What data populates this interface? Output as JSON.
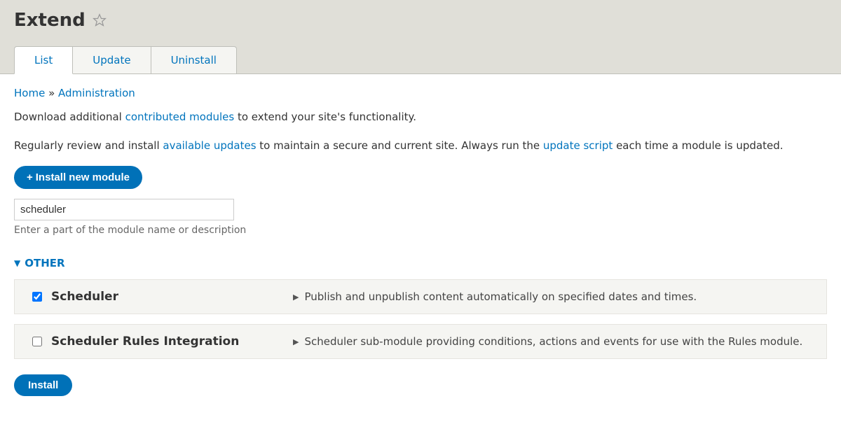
{
  "header": {
    "title": "Extend"
  },
  "tabs": [
    {
      "label": "List",
      "active": true
    },
    {
      "label": "Update",
      "active": false
    },
    {
      "label": "Uninstall",
      "active": false
    }
  ],
  "breadcrumb": {
    "home": "Home",
    "sep": " » ",
    "admin": "Administration"
  },
  "intro": {
    "pre1": "Download additional ",
    "link1": "contributed modules",
    "post1": " to extend your site's functionality.",
    "pre2": "Regularly review and install ",
    "link2": "available updates",
    "mid2": " to maintain a secure and current site. Always run the ",
    "link3": "update script",
    "post2": " each time a module is updated."
  },
  "install_new_button": "Install new module",
  "filter": {
    "value": "scheduler",
    "help": "Enter a part of the module name or description"
  },
  "section": {
    "title": "OTHER"
  },
  "modules": [
    {
      "name": "Scheduler",
      "desc": "Publish and unpublish content automatically on specified dates and times.",
      "checked": true
    },
    {
      "name": "Scheduler Rules Integration",
      "desc": "Scheduler sub-module providing conditions, actions and events for use with the Rules module.",
      "checked": false
    }
  ],
  "install_button": "Install"
}
